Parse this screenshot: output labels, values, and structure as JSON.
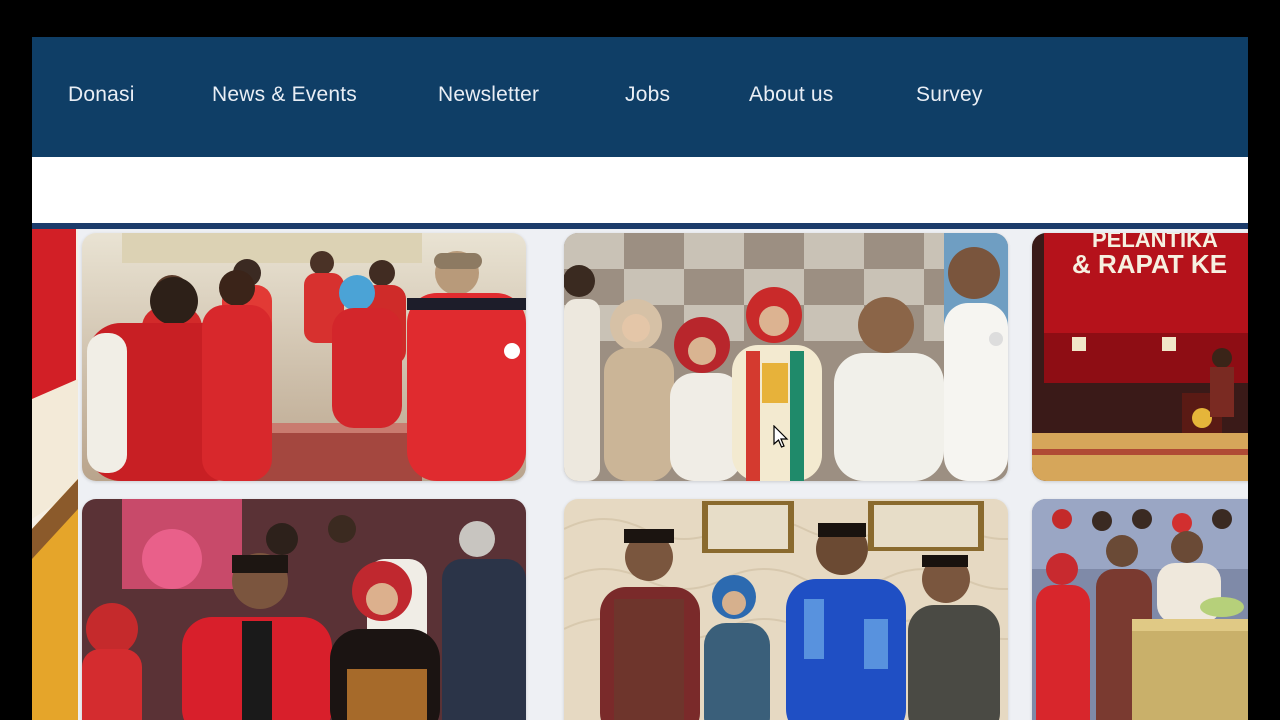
{
  "nav": {
    "items": [
      {
        "label": "Donasi"
      },
      {
        "label": "News & Events"
      },
      {
        "label": "Newsletter"
      },
      {
        "label": "Jobs"
      },
      {
        "label": "About us"
      },
      {
        "label": "Survey"
      }
    ]
  },
  "gallery": {
    "banner_text_line1": "PELANTIKA",
    "banner_text_line2": "& RAPAT KE"
  },
  "colors": {
    "nav_bg": "#0f3e66",
    "accent_red": "#d8222a",
    "rule": "#1b3b6a"
  }
}
